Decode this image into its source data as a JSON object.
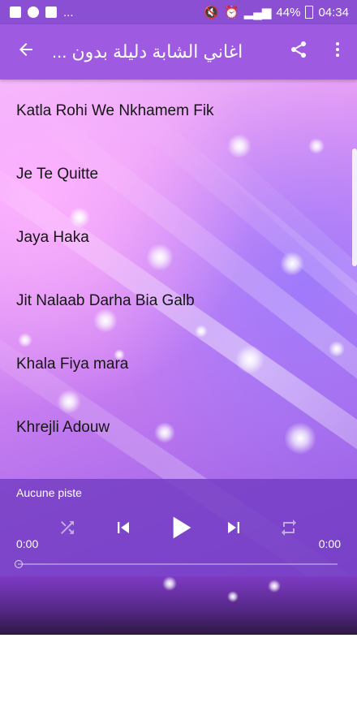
{
  "statusbar": {
    "left_icons": [
      "image-icon",
      "messenger-icon",
      "facebook-icon"
    ],
    "more": "...",
    "battery": "44%",
    "time": "04:34"
  },
  "toolbar": {
    "title": "اغاني الشابة دليلة بدون ...",
    "back_icon": "arrow-left-icon",
    "share_icon": "share-icon",
    "menu_icon": "more-vert-icon"
  },
  "songs": [
    "Katla Rohi We Nkhamem Fik",
    "Je Te Quitte",
    "Jaya Haka",
    "Jit Nalaab Darha Bia Galb",
    "Khala Fiya mara",
    "Khrejli Adouw"
  ],
  "player": {
    "track": "Aucune piste",
    "time_current": "0:00",
    "time_total": "0:00",
    "progress": 0
  },
  "colors": {
    "accent": "#9e5ae0",
    "status": "#8a4fd3"
  }
}
